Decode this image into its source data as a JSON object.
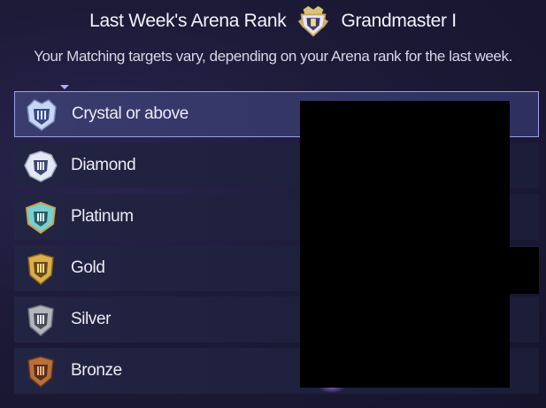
{
  "header": {
    "title": "Last Week's Arena Rank",
    "rank_name": "Grandmaster I",
    "rank_icon": "grandmaster-emblem-icon"
  },
  "subtitle": "Your Matching targets vary, depending on your Arena rank for the last week.",
  "tiers": [
    {
      "label": "Crystal or above",
      "icon": "crystal-emblem-icon",
      "selected": true,
      "color": "#b8c8f0"
    },
    {
      "label": "Diamond",
      "icon": "diamond-emblem-icon",
      "selected": false,
      "color": "#d8dff0"
    },
    {
      "label": "Platinum",
      "icon": "platinum-emblem-icon",
      "selected": false,
      "color": "#6fc6c8"
    },
    {
      "label": "Gold",
      "icon": "gold-emblem-icon",
      "selected": false,
      "color": "#d4a83a"
    },
    {
      "label": "Silver",
      "icon": "silver-emblem-icon",
      "selected": false,
      "color": "#a8acb4"
    },
    {
      "label": "Bronze",
      "icon": "bronze-emblem-icon",
      "selected": false,
      "color": "#b06a3a"
    }
  ]
}
